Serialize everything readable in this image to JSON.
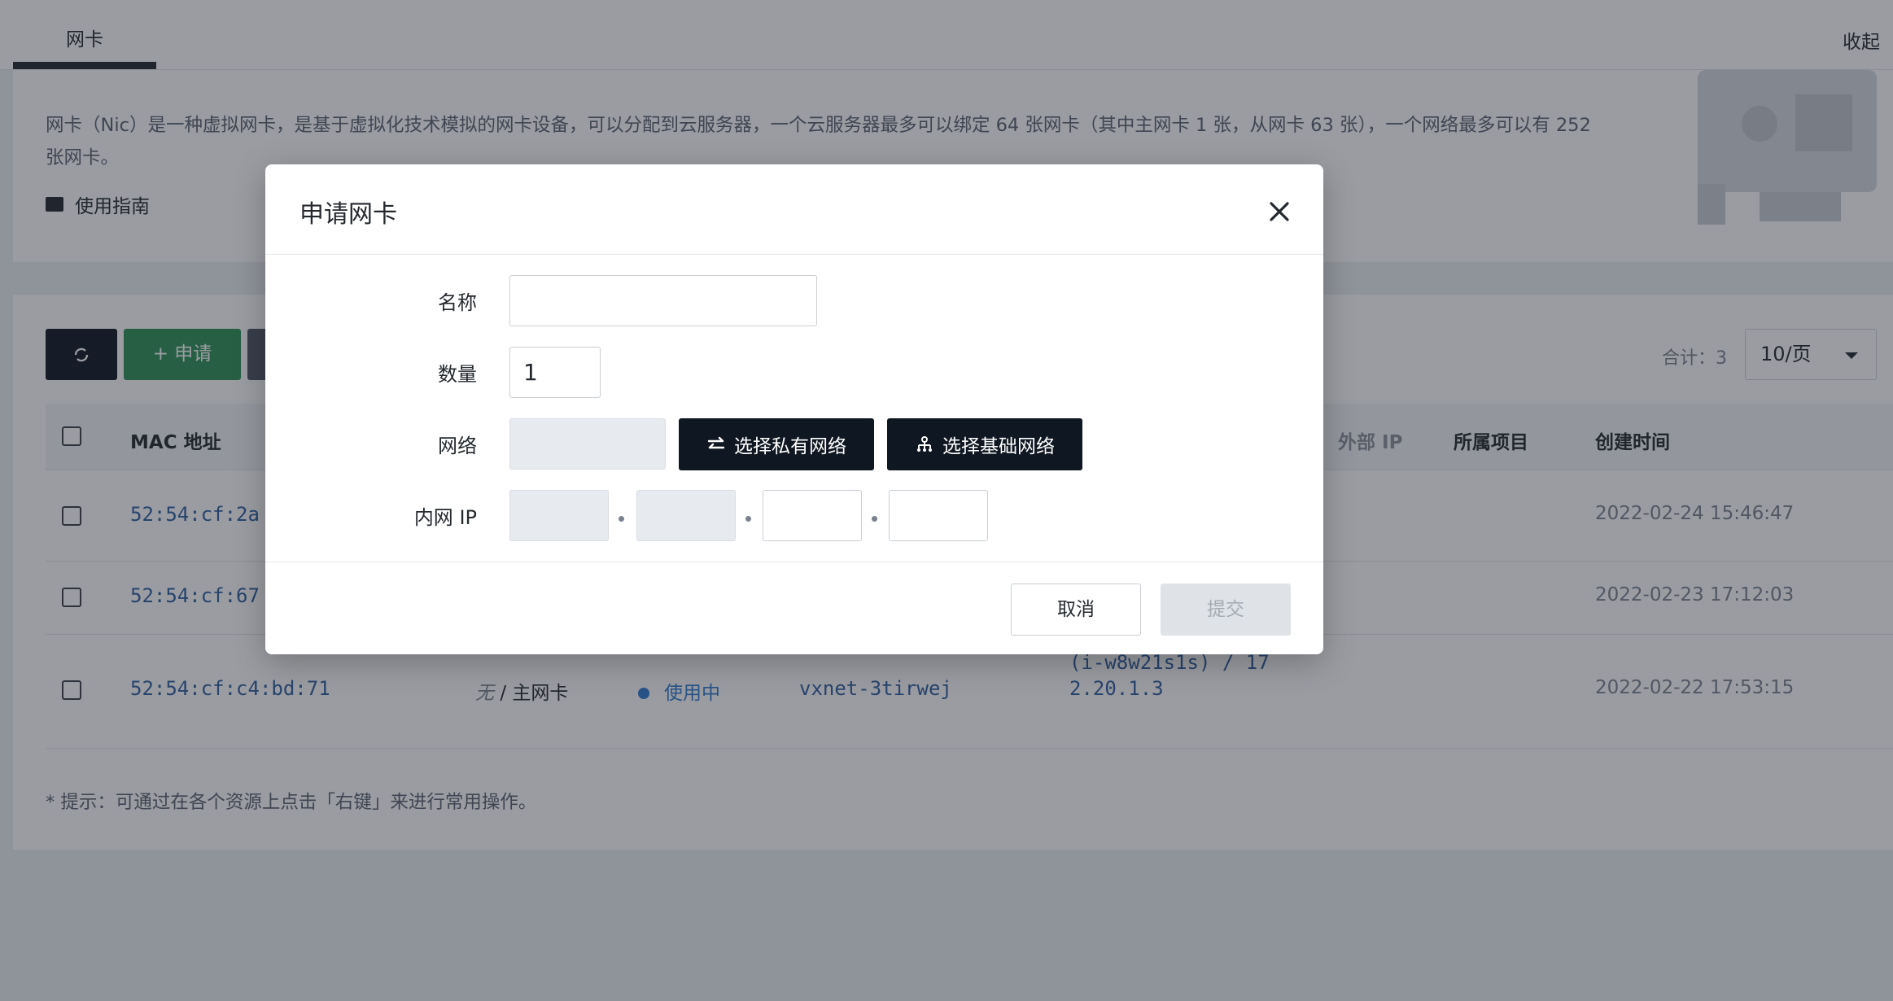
{
  "tabs": {
    "active_label": "网卡",
    "collapse_label": "收起"
  },
  "intro": {
    "description": "网卡（Nic）是一种虚拟网卡，是基于虚拟化技术模拟的网卡设备，可以分配到云服务器，一个云服务器最多可以绑定 64 张网卡（其中主网卡 1 张，从网卡 63 张），一个网络最多可以有 252 张网卡。",
    "guide_label": "使用指南"
  },
  "toolbar": {
    "refresh_icon": "refresh-icon",
    "apply_label": "+ 申请",
    "total_label": "合计：3",
    "page_size": "10/页"
  },
  "table": {
    "headers": {
      "mac": "MAC 地址",
      "external_ip": "外部 IP",
      "project": "所属项目",
      "created": "创建时间"
    },
    "rows": [
      {
        "mac": "52:54:cf:2a",
        "created": "2022-02-24 15:46:47"
      },
      {
        "mac": "52:54:cf:67",
        "created": "2022-02-23 17:12:03"
      },
      {
        "mac": "52:54:cf:c4:bd:71",
        "name": "无",
        "type": "/ 主网卡",
        "status": "使用中",
        "vxnet": "vxnet-3tirwej",
        "instance_line1": "(i-w8w21s1s) / 17",
        "instance_line2": "2.20.1.3",
        "created": "2022-02-22 17:53:15"
      }
    ]
  },
  "tip": "* 提示：可通过在各个资源上点击「右键」来进行常用操作。",
  "modal": {
    "title": "申请网卡",
    "close_icon": "close-icon",
    "fields": {
      "name_label": "名称",
      "name_value": "",
      "count_label": "数量",
      "count_value": "1",
      "network_label": "网络",
      "network_value": "",
      "private_btn": "选择私有网络",
      "basic_btn": "选择基础网络",
      "ip_label": "内网 IP",
      "ip_octets": [
        "",
        "",
        "",
        ""
      ]
    },
    "footer": {
      "cancel": "取消",
      "submit": "提交"
    }
  },
  "colors": {
    "dark_button": "#0f1722",
    "apply_green": "#2f9158",
    "link_blue": "#2f5fa0",
    "status_blue": "#2f7ad0"
  }
}
